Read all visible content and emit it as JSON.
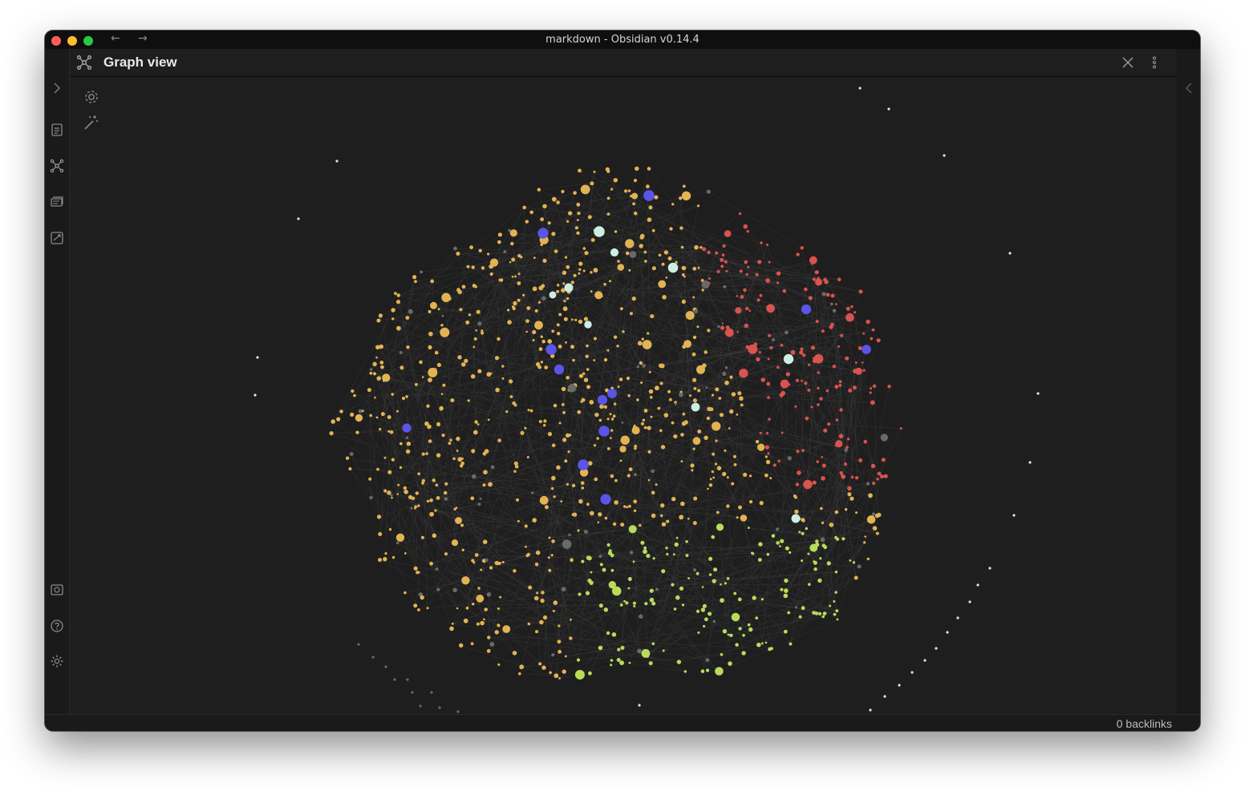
{
  "window": {
    "title": "markdown - Obsidian v0.14.4",
    "back_arrow": "←",
    "forward_arrow": "→"
  },
  "ribbon": {
    "top_icons": [
      "expand-sidebar-icon",
      "quick-switcher-icon",
      "graph-view-icon",
      "slides-icon",
      "random-note-icon"
    ],
    "bottom_icons": [
      "vault-icon",
      "help-icon",
      "settings-icon"
    ]
  },
  "pane": {
    "title": "Graph view",
    "icon": "graph-view-icon",
    "actions": [
      "close-icon",
      "more-options-icon"
    ]
  },
  "graph_controls": [
    "settings-icon",
    "magic-wand-icon"
  ],
  "graph": {
    "colors": {
      "orange": "#e3b353",
      "red": "#d9534f",
      "green": "#b8dc5a",
      "blue": "#5a55e6",
      "mint": "#cdeee2",
      "gray": "#6a6a6a",
      "edge": "#444444",
      "background": "#1e1e1e"
    }
  },
  "status_bar": {
    "backlinks": "0 backlinks"
  }
}
